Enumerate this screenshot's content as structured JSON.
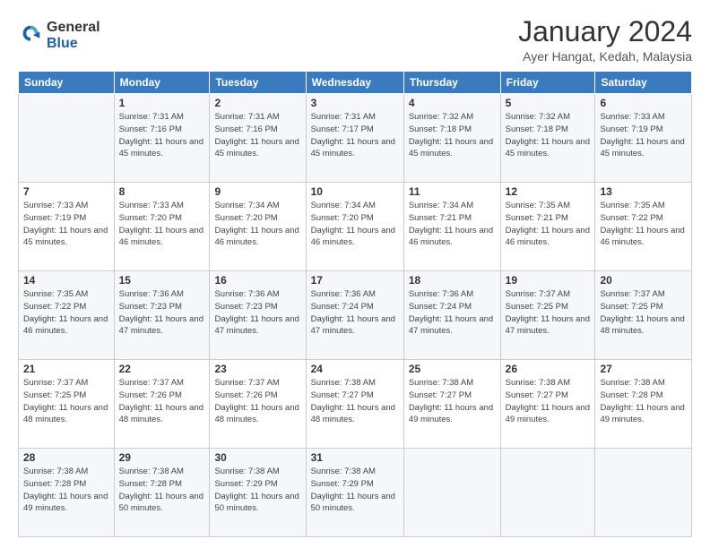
{
  "header": {
    "logo_general": "General",
    "logo_blue": "Blue",
    "month_title": "January 2024",
    "location": "Ayer Hangat, Kedah, Malaysia"
  },
  "weekdays": [
    "Sunday",
    "Monday",
    "Tuesday",
    "Wednesday",
    "Thursday",
    "Friday",
    "Saturday"
  ],
  "weeks": [
    [
      {
        "day": "",
        "sunrise": "",
        "sunset": "",
        "daylight": ""
      },
      {
        "day": "1",
        "sunrise": "Sunrise: 7:31 AM",
        "sunset": "Sunset: 7:16 PM",
        "daylight": "Daylight: 11 hours and 45 minutes."
      },
      {
        "day": "2",
        "sunrise": "Sunrise: 7:31 AM",
        "sunset": "Sunset: 7:16 PM",
        "daylight": "Daylight: 11 hours and 45 minutes."
      },
      {
        "day": "3",
        "sunrise": "Sunrise: 7:31 AM",
        "sunset": "Sunset: 7:17 PM",
        "daylight": "Daylight: 11 hours and 45 minutes."
      },
      {
        "day": "4",
        "sunrise": "Sunrise: 7:32 AM",
        "sunset": "Sunset: 7:18 PM",
        "daylight": "Daylight: 11 hours and 45 minutes."
      },
      {
        "day": "5",
        "sunrise": "Sunrise: 7:32 AM",
        "sunset": "Sunset: 7:18 PM",
        "daylight": "Daylight: 11 hours and 45 minutes."
      },
      {
        "day": "6",
        "sunrise": "Sunrise: 7:33 AM",
        "sunset": "Sunset: 7:19 PM",
        "daylight": "Daylight: 11 hours and 45 minutes."
      }
    ],
    [
      {
        "day": "7",
        "sunrise": "Sunrise: 7:33 AM",
        "sunset": "Sunset: 7:19 PM",
        "daylight": "Daylight: 11 hours and 45 minutes."
      },
      {
        "day": "8",
        "sunrise": "Sunrise: 7:33 AM",
        "sunset": "Sunset: 7:20 PM",
        "daylight": "Daylight: 11 hours and 46 minutes."
      },
      {
        "day": "9",
        "sunrise": "Sunrise: 7:34 AM",
        "sunset": "Sunset: 7:20 PM",
        "daylight": "Daylight: 11 hours and 46 minutes."
      },
      {
        "day": "10",
        "sunrise": "Sunrise: 7:34 AM",
        "sunset": "Sunset: 7:20 PM",
        "daylight": "Daylight: 11 hours and 46 minutes."
      },
      {
        "day": "11",
        "sunrise": "Sunrise: 7:34 AM",
        "sunset": "Sunset: 7:21 PM",
        "daylight": "Daylight: 11 hours and 46 minutes."
      },
      {
        "day": "12",
        "sunrise": "Sunrise: 7:35 AM",
        "sunset": "Sunset: 7:21 PM",
        "daylight": "Daylight: 11 hours and 46 minutes."
      },
      {
        "day": "13",
        "sunrise": "Sunrise: 7:35 AM",
        "sunset": "Sunset: 7:22 PM",
        "daylight": "Daylight: 11 hours and 46 minutes."
      }
    ],
    [
      {
        "day": "14",
        "sunrise": "Sunrise: 7:35 AM",
        "sunset": "Sunset: 7:22 PM",
        "daylight": "Daylight: 11 hours and 46 minutes."
      },
      {
        "day": "15",
        "sunrise": "Sunrise: 7:36 AM",
        "sunset": "Sunset: 7:23 PM",
        "daylight": "Daylight: 11 hours and 47 minutes."
      },
      {
        "day": "16",
        "sunrise": "Sunrise: 7:36 AM",
        "sunset": "Sunset: 7:23 PM",
        "daylight": "Daylight: 11 hours and 47 minutes."
      },
      {
        "day": "17",
        "sunrise": "Sunrise: 7:36 AM",
        "sunset": "Sunset: 7:24 PM",
        "daylight": "Daylight: 11 hours and 47 minutes."
      },
      {
        "day": "18",
        "sunrise": "Sunrise: 7:36 AM",
        "sunset": "Sunset: 7:24 PM",
        "daylight": "Daylight: 11 hours and 47 minutes."
      },
      {
        "day": "19",
        "sunrise": "Sunrise: 7:37 AM",
        "sunset": "Sunset: 7:25 PM",
        "daylight": "Daylight: 11 hours and 47 minutes."
      },
      {
        "day": "20",
        "sunrise": "Sunrise: 7:37 AM",
        "sunset": "Sunset: 7:25 PM",
        "daylight": "Daylight: 11 hours and 48 minutes."
      }
    ],
    [
      {
        "day": "21",
        "sunrise": "Sunrise: 7:37 AM",
        "sunset": "Sunset: 7:25 PM",
        "daylight": "Daylight: 11 hours and 48 minutes."
      },
      {
        "day": "22",
        "sunrise": "Sunrise: 7:37 AM",
        "sunset": "Sunset: 7:26 PM",
        "daylight": "Daylight: 11 hours and 48 minutes."
      },
      {
        "day": "23",
        "sunrise": "Sunrise: 7:37 AM",
        "sunset": "Sunset: 7:26 PM",
        "daylight": "Daylight: 11 hours and 48 minutes."
      },
      {
        "day": "24",
        "sunrise": "Sunrise: 7:38 AM",
        "sunset": "Sunset: 7:27 PM",
        "daylight": "Daylight: 11 hours and 48 minutes."
      },
      {
        "day": "25",
        "sunrise": "Sunrise: 7:38 AM",
        "sunset": "Sunset: 7:27 PM",
        "daylight": "Daylight: 11 hours and 49 minutes."
      },
      {
        "day": "26",
        "sunrise": "Sunrise: 7:38 AM",
        "sunset": "Sunset: 7:27 PM",
        "daylight": "Daylight: 11 hours and 49 minutes."
      },
      {
        "day": "27",
        "sunrise": "Sunrise: 7:38 AM",
        "sunset": "Sunset: 7:28 PM",
        "daylight": "Daylight: 11 hours and 49 minutes."
      }
    ],
    [
      {
        "day": "28",
        "sunrise": "Sunrise: 7:38 AM",
        "sunset": "Sunset: 7:28 PM",
        "daylight": "Daylight: 11 hours and 49 minutes."
      },
      {
        "day": "29",
        "sunrise": "Sunrise: 7:38 AM",
        "sunset": "Sunset: 7:28 PM",
        "daylight": "Daylight: 11 hours and 50 minutes."
      },
      {
        "day": "30",
        "sunrise": "Sunrise: 7:38 AM",
        "sunset": "Sunset: 7:29 PM",
        "daylight": "Daylight: 11 hours and 50 minutes."
      },
      {
        "day": "31",
        "sunrise": "Sunrise: 7:38 AM",
        "sunset": "Sunset: 7:29 PM",
        "daylight": "Daylight: 11 hours and 50 minutes."
      },
      {
        "day": "",
        "sunrise": "",
        "sunset": "",
        "daylight": ""
      },
      {
        "day": "",
        "sunrise": "",
        "sunset": "",
        "daylight": ""
      },
      {
        "day": "",
        "sunrise": "",
        "sunset": "",
        "daylight": ""
      }
    ]
  ]
}
